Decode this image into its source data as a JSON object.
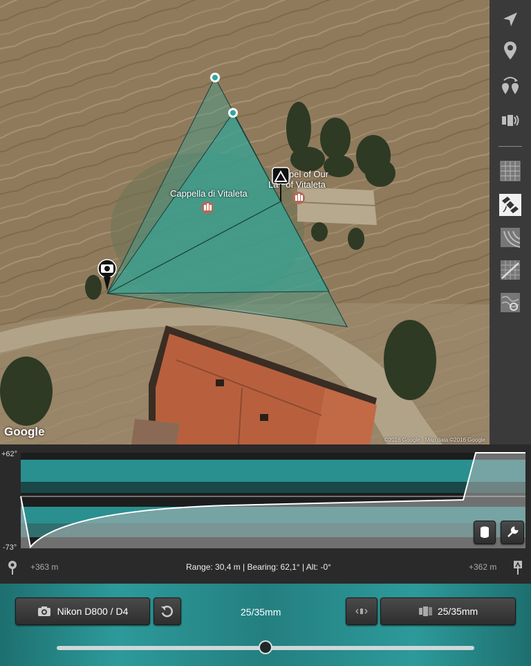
{
  "map": {
    "place_label_1": "Cappella di Vitaleta",
    "place_label_2_line1": "pel of Our",
    "place_label_2_line2": "La   of Vitaleta",
    "google_logo": "Google",
    "copyright": "©2016 Google · Map data ©2016 Google"
  },
  "toolbar": {
    "icons": [
      "navigate-arrow-icon",
      "location-pin-icon",
      "pins-swap-icon",
      "camera-sensor-icon",
      "grid-map-icon",
      "satellite-map-icon",
      "topo-map-icon",
      "hybrid-map-icon",
      "terrain-map-icon"
    ]
  },
  "profile": {
    "top_angle": "+62°",
    "bottom_angle": "-73°",
    "left_elevation": "+363 m",
    "right_elevation": "+362 m",
    "info": "Range: 30,4 m | Bearing: 62,1° | Alt: -0°"
  },
  "controls": {
    "camera_label": "Nikon D800 / D4",
    "focal_center": "25/35mm",
    "focal_button": "25/35mm",
    "slider_value": 0.5
  }
}
